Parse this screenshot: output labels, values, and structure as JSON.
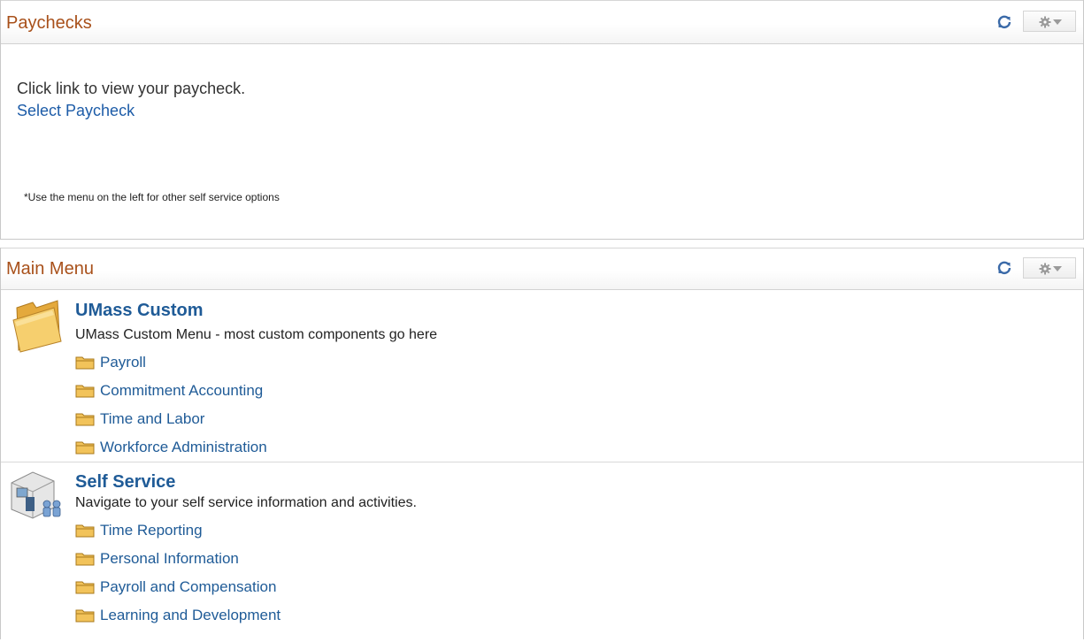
{
  "paychecks": {
    "title": "Paychecks",
    "instruction": "Click link to view your paycheck.",
    "link_label": "Select Paycheck",
    "note": "*Use the menu on the left for other self service options"
  },
  "main_menu": {
    "title": "Main Menu",
    "sections": [
      {
        "icon": "folder-icon",
        "title": "UMass Custom",
        "description": "UMass Custom Menu - most custom components go here",
        "items": [
          "Payroll",
          "Commitment Accounting",
          "Time and Labor",
          "Workforce Administration"
        ]
      },
      {
        "icon": "self-service-icon",
        "title": "Self Service",
        "description": "Navigate to your self service information and activities.",
        "items": [
          "Time Reporting",
          "Personal Information",
          "Payroll and Compensation",
          "Learning and Development"
        ]
      }
    ]
  },
  "icons": {
    "refresh": "refresh-icon",
    "options": "gear-icon",
    "folder": "small-folder-icon"
  },
  "colors": {
    "title": "#a8501a",
    "link": "#1f5b97",
    "folder": "#f2c35a"
  }
}
